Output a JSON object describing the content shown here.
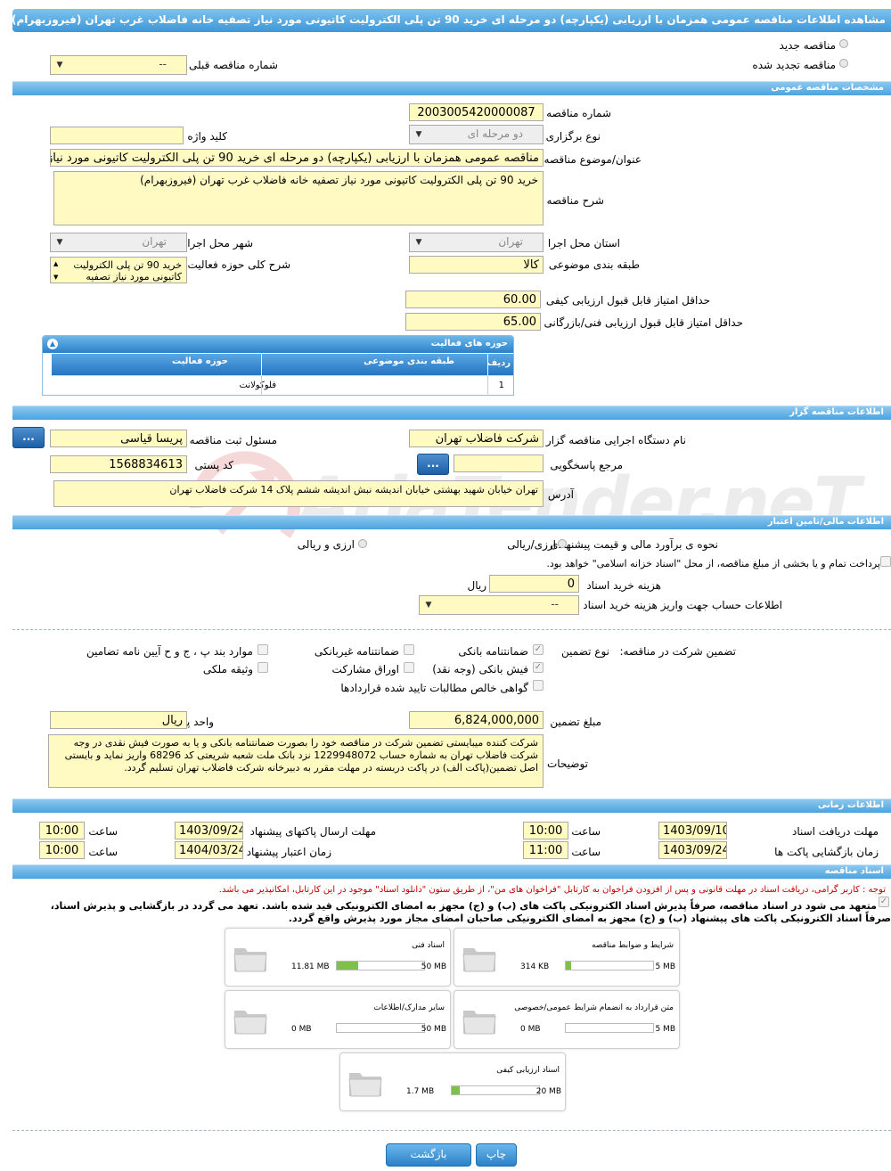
{
  "title": "مشاهده اطلاعات مناقصه عمومی همزمان با ارزیابی (یکپارچه) دو مرحله ای خرید 90 تن پلی الکترولیت کاتیونی مورد نیاز تصفیه خانه فاضلاب غرب تهران (فیروزبهرام)",
  "top": {
    "new_tender": "مناقصه جدید",
    "renewed_tender": "مناقصه تجدید شده",
    "prev_number_label": "شماره مناقصه قبلی",
    "prev_number_value": "--"
  },
  "general": {
    "header": "مشخصات مناقصه عمومی",
    "number_label": "شماره مناقصه",
    "number_value": "2003005420000087",
    "type_label": "نوع برگزاری",
    "type_value": "دو مرحله ای",
    "keyword_label": "کلید واژه",
    "keyword_value": "",
    "subject_label": "عنوان/موضوع مناقصه",
    "subject_value": "مناقصه عمومی همزمان با ارزیابی (یکپارچه) دو مرحله ای خرید 90 تن پلی الکترولیت کاتیونی مورد نیاز تصفیه خانه فاضلاب غرب تهران (فیروزبهرام)",
    "desc_label": "شرح مناقصه",
    "desc_value": "خرید 90 تن پلی الکترولیت کاتیونی مورد نیاز تصفیه خانه فاضلاب غرب تهران (فیروزبهرام)",
    "province_label": "استان محل اجرا",
    "province_value": "تهران",
    "city_label": "شهر محل اجرا",
    "city_value": "تهران",
    "category_label": "طبقه بندی موضوعی",
    "category_value": "کالا",
    "activity_label": "شرح کلی حوزه فعالیت",
    "activity_value": "خرید 90 تن پلی الکترولیت کاتیونی مورد نیاز تصفیه",
    "min_quality_label": "حداقل امتیاز قابل قبول ارزیابی کیفی",
    "min_quality_value": "60.00",
    "min_tech_label": "حداقل امتیاز قابل قبول ارزیابی فنی/بازرگانی",
    "min_tech_value": "65.00"
  },
  "activity_table": {
    "header": "حوزه های فعالیت",
    "col_row": "ردیف",
    "col_category": "طبقه بندی موضوعی",
    "col_field": "حوزه فعالیت",
    "rows": [
      {
        "row": "1",
        "category": "",
        "field": "فلوکولانت"
      }
    ]
  },
  "organizer": {
    "header": "اطلاعات مناقصه گزار",
    "org_label": "نام دستگاه اجرایی مناقصه گزار",
    "org_value": "شرکت فاضلاب تهران",
    "responsible_label": "مسئول ثبت مناقصه",
    "responsible_value": "پریسا  قیاسی",
    "ref_label": "مرجع پاسخگویی",
    "ref_value": "",
    "postal_label": "کد پستی",
    "postal_value": "1568834613",
    "address_label": "آدرس",
    "address_value": "تهران خیابان شهید بهشتی خیابان اندیشه نبش اندیشه ششم پلاک 14 شرکت فاضلاب تهران",
    "dots": "..."
  },
  "finance": {
    "header": "اطلاعات مالی/تامین اعتبار",
    "estimate_label": "نحوه ی برآورد مالی و قیمت پیشنهادی",
    "opt_rial": "ارزی/ریالی",
    "opt_both": "ارزی و ریالی",
    "treasury_text": "پرداخت تمام و یا بخشی از مبلغ مناقصه، از محل \"اسناد خزانه اسلامی\" خواهد بود.",
    "doc_fee_label": "هزینه خرید اسناد",
    "doc_fee_value": "0",
    "doc_fee_unit": "ریال",
    "account_label": "اطلاعات حساب جهت واریز هزینه خرید اسناد",
    "account_value": "--"
  },
  "guarantee": {
    "label": "تضمین شرکت در مناقصه:",
    "type_label": "نوع تضمین",
    "opts": [
      "ضمانتنامه بانکی",
      "ضمانتنامه غیربانکی",
      "موارد بند پ ، ج و ح آیین نامه تضامین",
      "فیش بانکی (وجه نقد)",
      "اوراق مشارکت",
      "وثیقه ملکی",
      "گواهی خالص مطالبات تایید شده قراردادها"
    ],
    "amount_label": "مبلغ تضمین",
    "amount_value": "6,824,000,000",
    "unit_label": "واحد پول",
    "unit_value": "ریال",
    "notes_label": "توضیحات",
    "notes_value": "شرکت کننده میبایستی تضمین شرکت در مناقصه خود را بصورت ضمانتنامه بانکی و یا به صورت فیش نقدی در وجه شرکت فاضلاب تهران به شماره حساب 1229948072 نزد بانک ملت شعبه شریعتی کد 68296 واریز نماید و بایستی اصل تضمین(پاکت الف) در پاکت دربسته در مهلت مقرر به دبیرخانه شرکت فاضلاب تهران تسلیم گردد."
  },
  "timing": {
    "header": "اطلاعات زمانی",
    "receive_label": "مهلت دریافت اسناد",
    "receive_date": "1403/09/10",
    "receive_time": "10:00",
    "send_label": "مهلت ارسال پاکتهای پیشنهاد",
    "send_date": "1403/09/24",
    "send_time": "10:00",
    "open_label": "زمان بازگشایی پاکت ها",
    "open_date": "1403/09/24",
    "open_time": "11:00",
    "valid_label": "زمان اعتبار پیشنهاد",
    "valid_date": "1404/03/24",
    "valid_time": "10:00",
    "time_label": "ساعت"
  },
  "documents": {
    "header": "اسناد مناقصه",
    "note_red": "توجه : کاربر گرامی، دریافت اسناد در مهلت قانونی و پس از افزودن فراخوان به کارتابل \"فراخوان های من\"، از طریق ستون \"دانلود اسناد\" موجود در این کارتابل، امکانپذیر می باشد.",
    "note_bold_1": "متعهد می شود در اسناد مناقصه، صرفاً پذیرش اسناد الکترونیکی پاکت های (ب) و (ج) مجهز به امضای الکترونیکی قید شده باشد. تعهد می گردد در بازگشایی و پذیرش اسناد،",
    "note_bold_2": "صرفاً اسناد الکترونیکی پاکت های پیشنهاد (ب) و (ج) مجهز به امضای الکترونیکی صاحبان امضای مجاز مورد پذیرش واقع گردد.",
    "files": [
      {
        "name": "شرایط و ضوابط مناقصه",
        "size": "314 KB",
        "max": "5 MB",
        "pct": 6
      },
      {
        "name": "اسناد فنی",
        "size": "11.81 MB",
        "max": "50 MB",
        "pct": 24
      },
      {
        "name": "متن قرارداد به انضمام شرایط عمومی/خصوصی",
        "size": "0 MB",
        "max": "5 MB",
        "pct": 0
      },
      {
        "name": "سایر مدارک/اطلاعات",
        "size": "0 MB",
        "max": "50 MB",
        "pct": 0
      },
      {
        "name": "اسناد ارزیابی کیفی",
        "size": "1.7 MB",
        "max": "20 MB",
        "pct": 9
      }
    ]
  },
  "buttons": {
    "print": "چاپ",
    "back": "بازگشت"
  },
  "watermark": "AriaTender.neT",
  "colors": {
    "bar": "#4aa3de",
    "field": "#fff9c2",
    "note_red": "#c00000"
  }
}
